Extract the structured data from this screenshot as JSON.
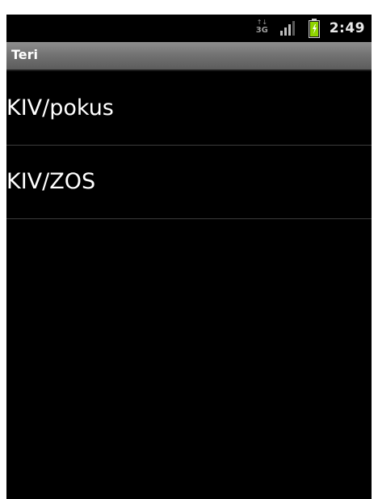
{
  "status_bar": {
    "network_label": "3G",
    "network_arrows": "↑↓",
    "time": "2:49",
    "battery_color": "#8fd400"
  },
  "app": {
    "title": "Teri"
  },
  "list": {
    "items": [
      {
        "label": "KIV/pokus"
      },
      {
        "label": "KIV/ZOS"
      }
    ]
  }
}
